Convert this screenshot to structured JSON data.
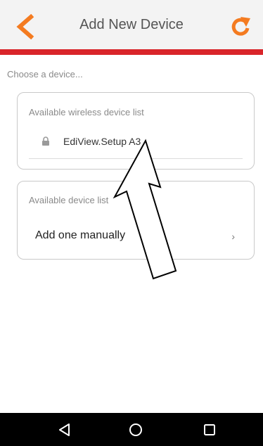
{
  "header": {
    "title": "Add New Device",
    "back_icon": "chevron-left-icon",
    "refresh_icon": "refresh-icon",
    "accent_color": "#f47b20",
    "bar_color": "#d9252a"
  },
  "content": {
    "choose_label": "Choose a device..."
  },
  "wireless_card": {
    "title": "Available wireless device list",
    "devices": [
      {
        "name": "EdiView.Setup A3",
        "icon": "lock-icon"
      }
    ]
  },
  "device_card": {
    "title": "Available device list",
    "manual_label": "Add one manually",
    "chevron": "›"
  },
  "navbar": {
    "back_icon": "nav-back-icon",
    "home_icon": "nav-home-icon",
    "recents_icon": "nav-recents-icon"
  }
}
